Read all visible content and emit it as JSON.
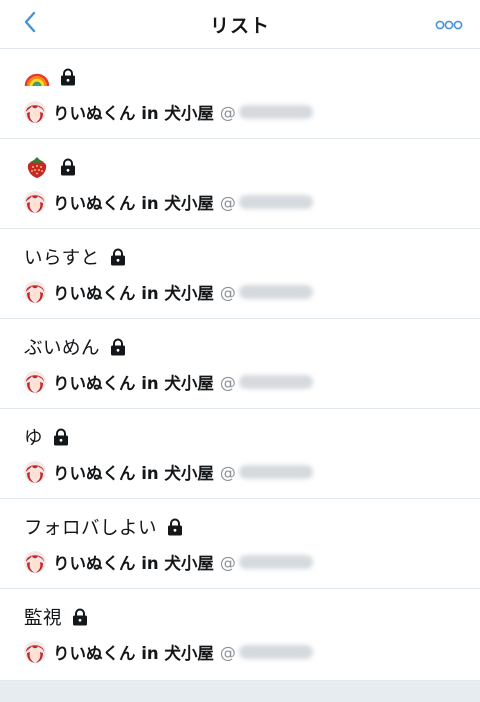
{
  "header": {
    "title": "リスト",
    "back_icon": "chevron-left-icon",
    "more_icon": "more-horizontal-icon",
    "accent_color": "#4a90d9"
  },
  "owner": {
    "display_name": "りいぬくん in 犬小屋",
    "handle_prefix": "@"
  },
  "lists": [
    {
      "name": "",
      "emoji_icon": "rainbow-icon",
      "private": true
    },
    {
      "name": "",
      "emoji_icon": "strawberry-icon",
      "private": true
    },
    {
      "name": "いらすと",
      "private": true
    },
    {
      "name": "ぶいめん",
      "private": true
    },
    {
      "name": "ゆ",
      "private": true
    },
    {
      "name": "フォロバしよい",
      "private": true
    },
    {
      "name": "監視",
      "private": true
    }
  ]
}
